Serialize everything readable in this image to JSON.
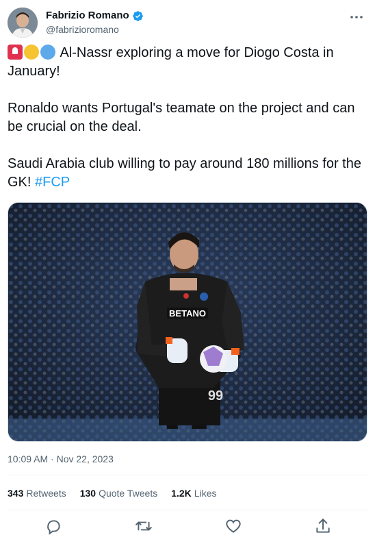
{
  "author": {
    "display_name": "Fabrizio Romano",
    "handle": "@fabrizioromano",
    "verified": true
  },
  "tweet": {
    "emojis": [
      "siren-emoji",
      "yellow-circle-emoji",
      "blue-circle-emoji"
    ],
    "line1": "Al-Nassr exploring a move for Diogo Costa in January!",
    "line2": "Ronaldo wants Portugal's teamate on the project and can be crucial on the deal.",
    "line3": "Saudi Arabia club willing to pay around 180 millions for the GK! ",
    "hashtag": "#FCP"
  },
  "media": {
    "description_icon": "photo-goalkeeper",
    "sponsor_text": "BETANO",
    "shirt_number": "99"
  },
  "timestamp": "10:09 AM · Nov 22, 2023",
  "stats": {
    "retweets_count": "343",
    "retweets_label": "Retweets",
    "quotes_count": "130",
    "quotes_label": "Quote Tweets",
    "likes_count": "1.2K",
    "likes_label": "Likes"
  },
  "actions": [
    "reply-icon",
    "retweet-icon",
    "like-icon",
    "share-icon"
  ],
  "colors": {
    "accent": "#1d9bf0",
    "text": "#0f1419",
    "secondary": "#536471",
    "divider": "#eff3f4"
  }
}
